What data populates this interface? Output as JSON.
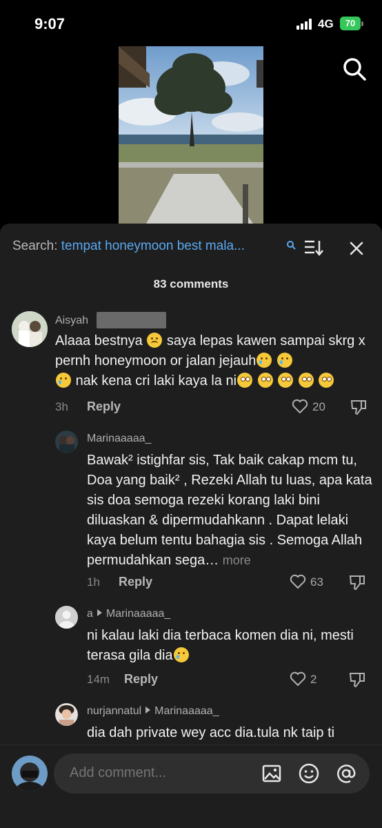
{
  "status_bar": {
    "time": "9:07",
    "network": "4G",
    "battery": "70"
  },
  "search": {
    "label": "Search:",
    "query": "tempat honeymoon best mala..."
  },
  "comments_count": "83 comments",
  "comments": [
    {
      "username": "Aisyah",
      "text_parts": [
        "Alaaa bestnya",
        "saya lepas kawen sampai skrg x pernh honeymoon or jalan jejauh",
        "nak kena cri laki kaya la ni"
      ],
      "time": "3h",
      "reply": "Reply",
      "likes": "20"
    },
    {
      "username": "Marinaaaaa_",
      "text": "Bawak² istighfar sis, Tak baik cakap mcm tu, Doa yang baik² , Rezeki Allah tu luas, apa kata sis doa semoga rezeki korang laki bini diluaskan & dipermudahkann . Dapat lelaki kaya belum tentu bahagia sis . Semoga Allah permudahkan sega…",
      "more": "more",
      "time": "1h",
      "reply": "Reply",
      "likes": "63"
    },
    {
      "username": "a",
      "reply_to": "Marinaaaaa_",
      "text": "ni kalau laki dia terbaca komen dia ni, mesti terasa gila dia",
      "time": "14m",
      "reply": "Reply",
      "likes": "2"
    },
    {
      "username": "nurjannatul",
      "reply_to": "Marinaaaaa_",
      "text": "dia dah private wey acc dia.tula nk taip ti"
    }
  ],
  "composer": {
    "placeholder": "Add comment..."
  },
  "icons": [
    "search-icon",
    "sort-icon",
    "close-icon",
    "heart-icon",
    "dislike-icon",
    "image-icon",
    "emoji-icon",
    "mention-icon"
  ],
  "colors": {
    "accent": "#5aa8f0",
    "sheet": "#1e1e1e",
    "battery": "#34c759"
  }
}
